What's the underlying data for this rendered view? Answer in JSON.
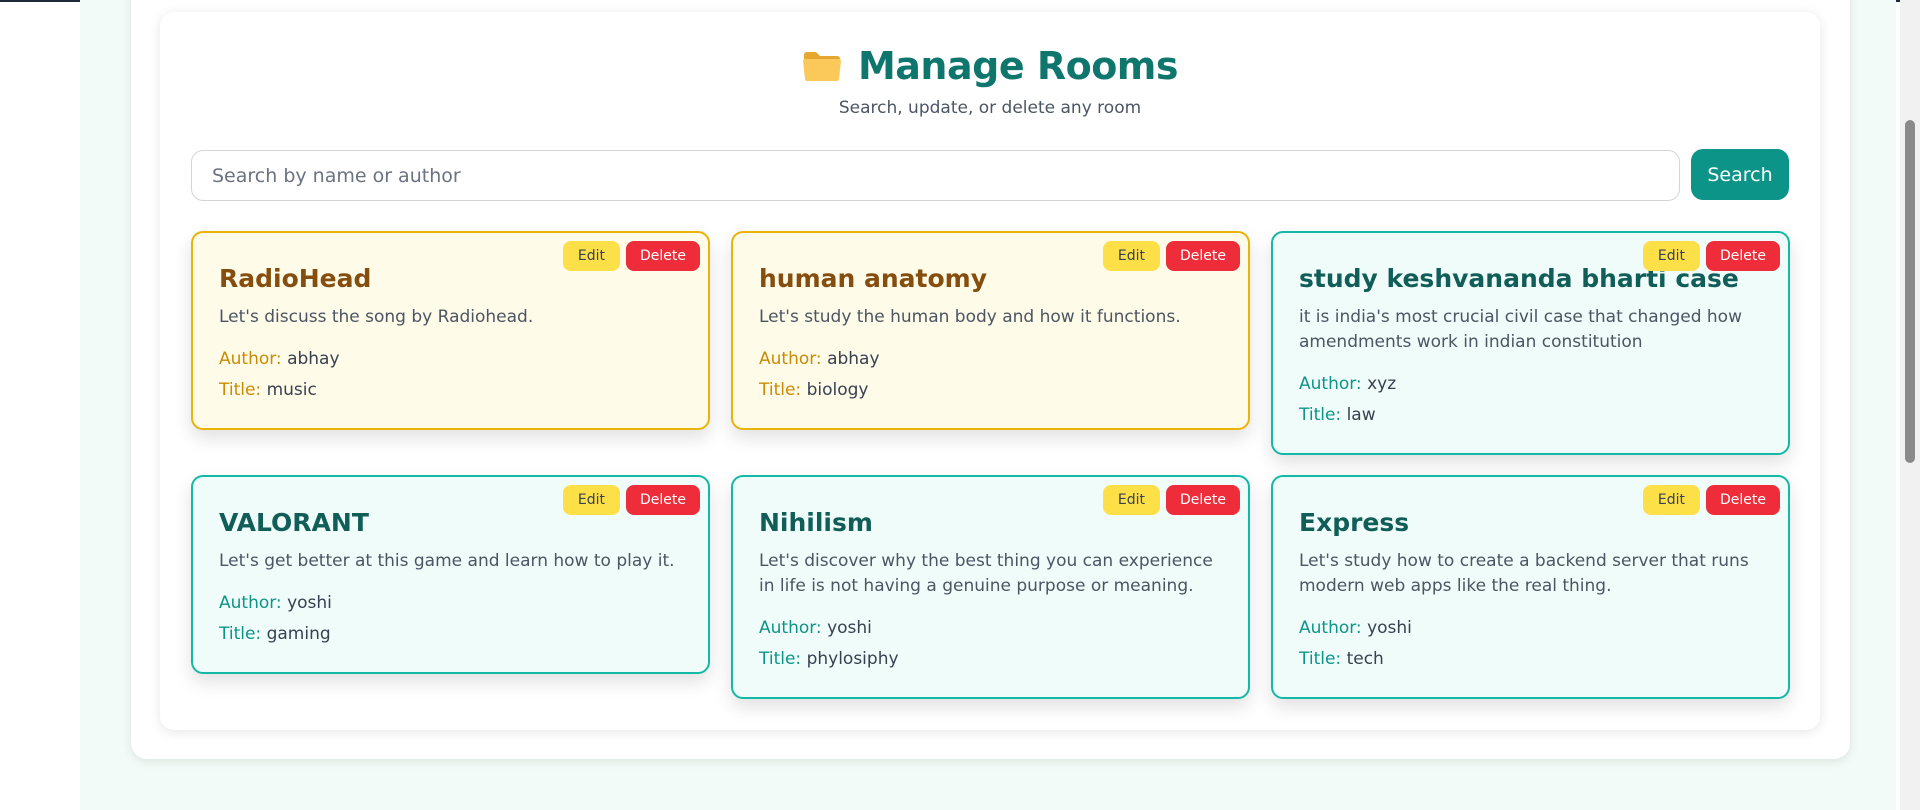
{
  "header": {
    "icon": "folder-icon",
    "title": "Manage Rooms",
    "subtitle": "Search, update, or delete any room"
  },
  "search": {
    "placeholder": "Search by name or author",
    "value": "",
    "button_label": "Search"
  },
  "labels": {
    "author": "Author:",
    "category": "Title:",
    "edit": "Edit",
    "delete": "Delete"
  },
  "rooms": [
    {
      "name": "RadioHead",
      "description": "Let's discuss the song by Radiohead.",
      "author": "abhay",
      "category": "music",
      "theme": "yellow"
    },
    {
      "name": "human anatomy",
      "description": "Let's study the human body and how it functions.",
      "author": "abhay",
      "category": "biology",
      "theme": "yellow"
    },
    {
      "name": "study keshvananda bharti case",
      "description": "it is india's most crucial civil case that changed how amendments work in indian constitution",
      "author": "xyz",
      "category": "law",
      "theme": "teal"
    },
    {
      "name": "VALORANT",
      "description": "Let's get better at this game and learn how to play it.",
      "author": "yoshi",
      "category": "gaming",
      "theme": "teal"
    },
    {
      "name": "Nihilism",
      "description": "Let's discover why the best thing you can experience in life is not having a genuine purpose or meaning.",
      "author": "yoshi",
      "category": "phylosiphy",
      "theme": "teal"
    },
    {
      "name": "Express",
      "description": "Let's study how to create a backend server that runs modern web apps like the real thing.",
      "author": "yoshi",
      "category": "tech",
      "theme": "teal"
    }
  ],
  "colors": {
    "accent": "#0d9488",
    "title": "#0f766e",
    "edit_button": "#fde047",
    "delete_button": "#ef2d3a",
    "yellow_card_bg": "#fefbe8",
    "yellow_card_border": "#eab308",
    "teal_card_bg": "#effcf9",
    "teal_card_border": "#14b8a6"
  }
}
